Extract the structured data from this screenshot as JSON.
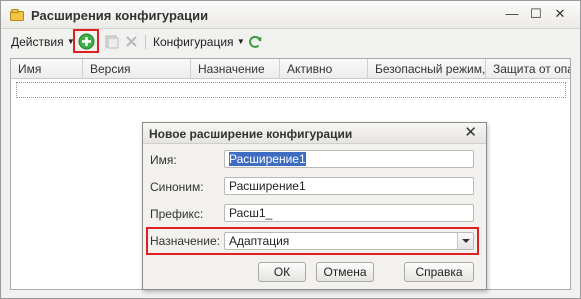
{
  "window": {
    "title": "Расширения конфигурации",
    "controls": {
      "minimize": "—",
      "maximize": "☐",
      "close": "✕"
    }
  },
  "toolbar": {
    "actions_label": "Действия",
    "configuration_label": "Конфигурация",
    "icons": [
      "add-icon",
      "copy-icon",
      "delete-icon",
      "refresh-icon"
    ],
    "highlight_color": "#e02020"
  },
  "table": {
    "columns": [
      "Имя",
      "Версия",
      "Назначение",
      "Активно",
      "Безопасный режим,...",
      "Защита от опа..."
    ]
  },
  "dialog": {
    "title": "Новое расширение конфигурации",
    "close": "✕",
    "fields": {
      "name": {
        "label": "Имя:",
        "value": "Расширение1"
      },
      "synonym": {
        "label": "Синоним:",
        "value": "Расширение1"
      },
      "prefix": {
        "label": "Префикс:",
        "value": "Расш1_"
      },
      "purpose": {
        "label": "Назначение:",
        "value": "Адаптация"
      }
    },
    "buttons": {
      "ok": "ОК",
      "cancel": "Отмена",
      "help": "Справка"
    }
  }
}
